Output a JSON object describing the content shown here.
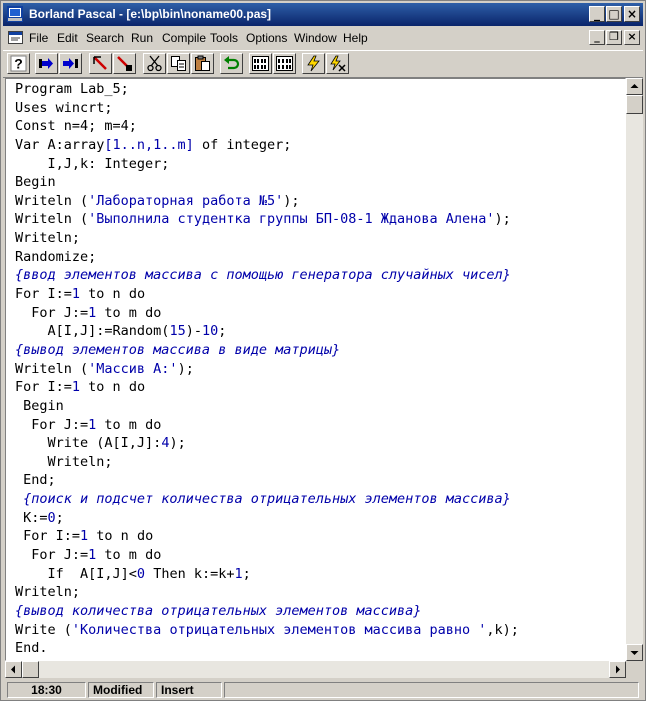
{
  "window": {
    "title": "Borland Pascal - [e:\\bp\\bin\\noname00.pas]",
    "title_buttons": {
      "minimize": "_",
      "maximize": "□",
      "close": "×"
    }
  },
  "menu": {
    "items": [
      {
        "id": "file",
        "label": "File"
      },
      {
        "id": "edit",
        "label": "Edit"
      },
      {
        "id": "search",
        "label": "Search"
      },
      {
        "id": "run",
        "label": "Run"
      },
      {
        "id": "compile",
        "label": "Compile"
      },
      {
        "id": "tools",
        "label": "Tools"
      },
      {
        "id": "options",
        "label": "Options"
      },
      {
        "id": "window",
        "label": "Window"
      },
      {
        "id": "help",
        "label": "Help"
      }
    ],
    "mdi_buttons": {
      "minimize": "_",
      "restore": "❐",
      "close": "×"
    }
  },
  "toolbar": {
    "buttons": [
      "help-icon",
      "step-over-icon",
      "trace-into-icon",
      "goto-cursor-icon",
      "breakpoint-icon",
      "cut-icon",
      "copy-icon",
      "paste-icon",
      "undo-icon",
      "compile-icon",
      "make-icon",
      "run-icon",
      "debug-run-icon"
    ],
    "help_glyph": "?"
  },
  "editor": {
    "lines": [
      [
        {
          "t": "k",
          "v": "Program Lab_5;"
        }
      ],
      [
        {
          "t": "k",
          "v": "Uses wincrt;"
        }
      ],
      [
        {
          "t": "k",
          "v": "Const n=4; m=4;"
        }
      ],
      [
        {
          "t": "k",
          "v": "Var A:array"
        },
        {
          "t": "n",
          "v": "[1..n,1..m]"
        },
        {
          "t": "k",
          "v": " of integer;"
        }
      ],
      [
        {
          "t": "k",
          "v": "    I,J,k: Integer;"
        }
      ],
      [
        {
          "t": "k",
          "v": "Begin"
        }
      ],
      [
        {
          "t": "k",
          "v": "Writeln ("
        },
        {
          "t": "s",
          "v": "'Лабораторная работа №5'"
        },
        {
          "t": "k",
          "v": ");"
        }
      ],
      [
        {
          "t": "k",
          "v": "Writeln ("
        },
        {
          "t": "s",
          "v": "'Выполнила студентка группы БП-08-1 Жданова Алена'"
        },
        {
          "t": "k",
          "v": ");"
        }
      ],
      [
        {
          "t": "k",
          "v": "Writeln;"
        }
      ],
      [
        {
          "t": "k",
          "v": "Randomize;"
        }
      ],
      [
        {
          "t": "c",
          "v": "{ввод элементов массива с помощью генератора случайных чисел}"
        }
      ],
      [
        {
          "t": "k",
          "v": "For I:="
        },
        {
          "t": "n",
          "v": "1"
        },
        {
          "t": "k",
          "v": " to n do"
        }
      ],
      [
        {
          "t": "k",
          "v": "  For J:="
        },
        {
          "t": "n",
          "v": "1"
        },
        {
          "t": "k",
          "v": " to m do"
        }
      ],
      [
        {
          "t": "k",
          "v": "    A[I,J]:=Random("
        },
        {
          "t": "n",
          "v": "15"
        },
        {
          "t": "k",
          "v": ")-"
        },
        {
          "t": "n",
          "v": "10"
        },
        {
          "t": "k",
          "v": ";"
        }
      ],
      [
        {
          "t": "c",
          "v": "{вывод элементов массива в виде матрицы}"
        }
      ],
      [
        {
          "t": "k",
          "v": "Writeln ("
        },
        {
          "t": "s",
          "v": "'Массив А:'"
        },
        {
          "t": "k",
          "v": ");"
        }
      ],
      [
        {
          "t": "k",
          "v": "For I:="
        },
        {
          "t": "n",
          "v": "1"
        },
        {
          "t": "k",
          "v": " to n do"
        }
      ],
      [
        {
          "t": "k",
          "v": " Begin"
        }
      ],
      [
        {
          "t": "k",
          "v": "  For J:="
        },
        {
          "t": "n",
          "v": "1"
        },
        {
          "t": "k",
          "v": " to m do"
        }
      ],
      [
        {
          "t": "k",
          "v": "    Write (A[I,J]:"
        },
        {
          "t": "n",
          "v": "4"
        },
        {
          "t": "k",
          "v": ");"
        }
      ],
      [
        {
          "t": "k",
          "v": "    Writeln;"
        }
      ],
      [
        {
          "t": "k",
          "v": " End;"
        }
      ],
      [
        {
          "t": "c",
          "v": " {поиск и подсчет количества отрицательных элементов массива}"
        }
      ],
      [
        {
          "t": "k",
          "v": " K:="
        },
        {
          "t": "n",
          "v": "0"
        },
        {
          "t": "k",
          "v": ";"
        }
      ],
      [
        {
          "t": "k",
          "v": " For I:="
        },
        {
          "t": "n",
          "v": "1"
        },
        {
          "t": "k",
          "v": " to n do"
        }
      ],
      [
        {
          "t": "k",
          "v": "  For J:="
        },
        {
          "t": "n",
          "v": "1"
        },
        {
          "t": "k",
          "v": " to m do"
        }
      ],
      [
        {
          "t": "k",
          "v": "    If  A[I,J]<"
        },
        {
          "t": "n",
          "v": "0"
        },
        {
          "t": "k",
          "v": " Then k:=k+"
        },
        {
          "t": "n",
          "v": "1"
        },
        {
          "t": "k",
          "v": ";"
        }
      ],
      [
        {
          "t": "k",
          "v": "Writeln;"
        }
      ],
      [
        {
          "t": "c",
          "v": "{вывод количества отрицательных элементов массива}"
        }
      ],
      [
        {
          "t": "k",
          "v": "Write ("
        },
        {
          "t": "s",
          "v": "'Количества отрицательных элементов массива равно '"
        },
        {
          "t": "k",
          "v": ",k);"
        }
      ],
      [
        {
          "t": "k",
          "v": "End."
        }
      ]
    ]
  },
  "status": {
    "position": "18:30",
    "modified": "Modified",
    "mode": "Insert"
  },
  "colors": {
    "title_bar": "#0a246a",
    "syntax_string": "#0000aa",
    "syntax_comment": "#0000aa",
    "editor_bg": "#ffffff"
  }
}
